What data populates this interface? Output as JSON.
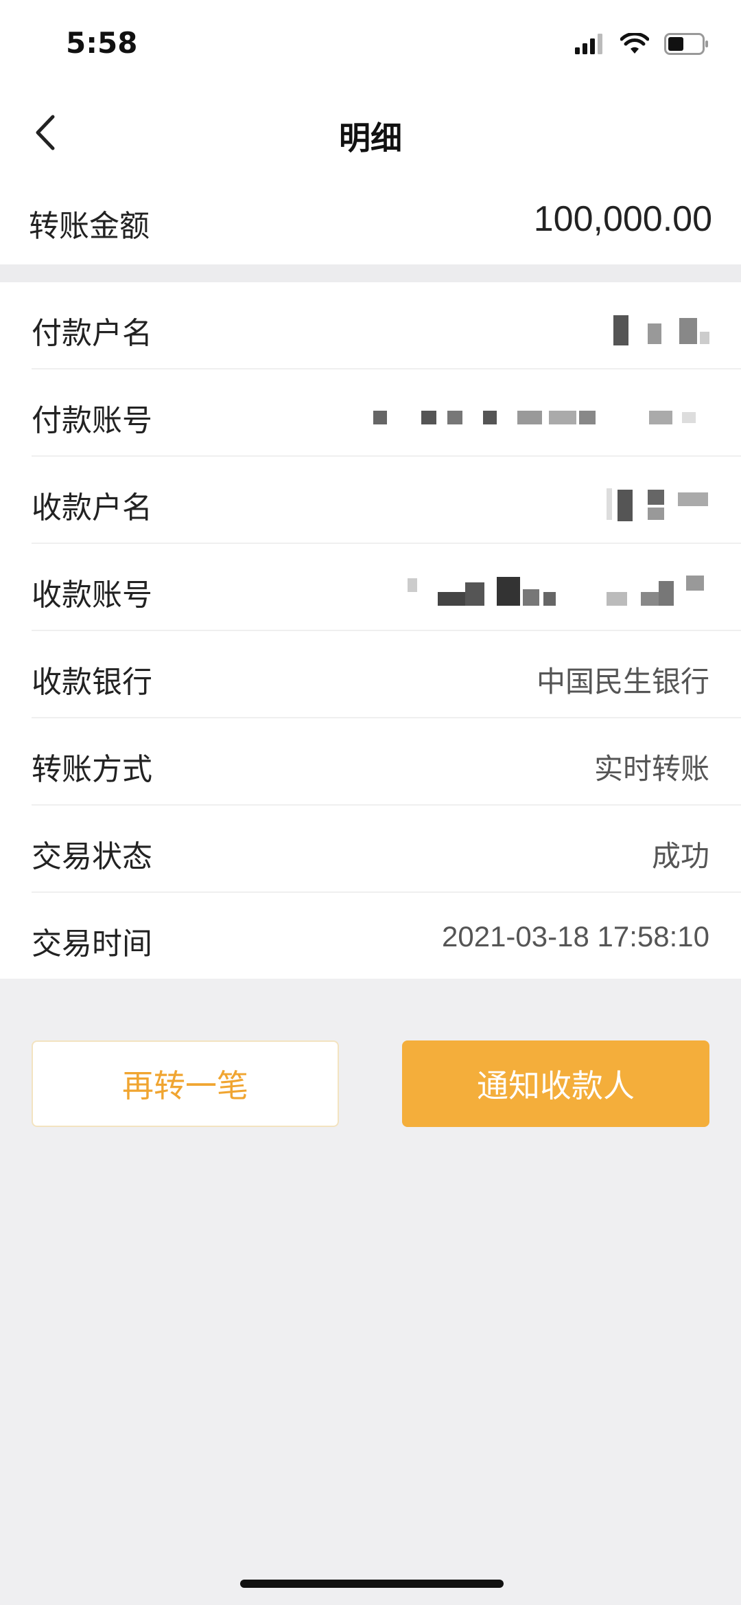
{
  "status_bar": {
    "time": "5:58",
    "icons": [
      "signal-icon",
      "wifi-icon",
      "battery-icon"
    ]
  },
  "nav": {
    "title": "明细",
    "back_icon": "chevron-left-icon"
  },
  "amount": {
    "label": "转账金额",
    "value": "100,000.00"
  },
  "details": [
    {
      "label": "付款户名",
      "value": "",
      "masked": true
    },
    {
      "label": "付款账号",
      "value": "",
      "masked": true
    },
    {
      "label": "收款户名",
      "value": "",
      "masked": true
    },
    {
      "label": "收款账号",
      "value": "",
      "masked": true
    },
    {
      "label": "收款银行",
      "value": "中国民生银行",
      "masked": false
    },
    {
      "label": "转账方式",
      "value": "实时转账",
      "masked": false
    },
    {
      "label": "交易状态",
      "value": "成功",
      "masked": false
    },
    {
      "label": "交易时间",
      "value": "2021-03-18 17:58:10",
      "masked": false
    }
  ],
  "actions": {
    "transfer_again": "再转一笔",
    "notify_payee": "通知收款人"
  },
  "colors": {
    "accent": "#f4ae3b",
    "accent_text": "#f0a531",
    "background": "#efeff1"
  }
}
